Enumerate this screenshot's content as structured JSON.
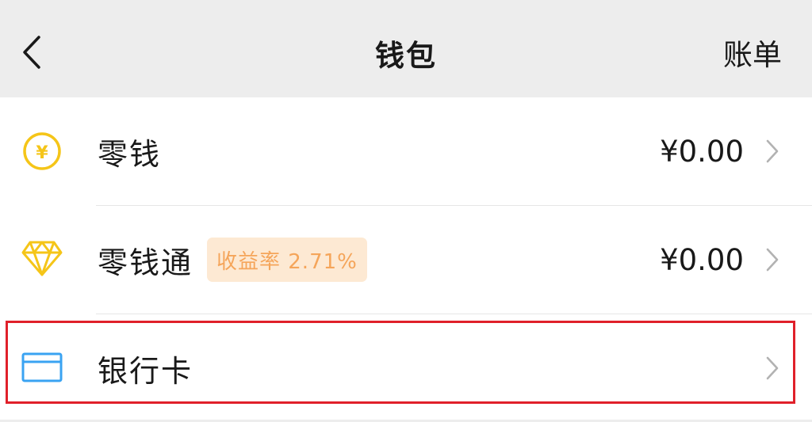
{
  "header": {
    "title": "钱包",
    "right_action": "账单",
    "back_icon": "chevron-left-icon"
  },
  "rows": [
    {
      "label": "零钱",
      "value": "¥0.00",
      "icon": "yuan-coin-icon",
      "icon_color": "#f5c518"
    },
    {
      "label": "零钱通",
      "badge": "收益率 2.71%",
      "value": "¥0.00",
      "icon": "diamond-icon",
      "icon_color": "#f5c518"
    },
    {
      "label": "银行卡",
      "icon": "bank-card-icon",
      "icon_color": "#3aa3f2"
    }
  ],
  "colors": {
    "header_bg": "#ededed",
    "list_bg": "#ffffff",
    "badge_bg": "#fde9d3",
    "badge_text": "#f5a55a",
    "highlight_border": "#e0202a"
  }
}
